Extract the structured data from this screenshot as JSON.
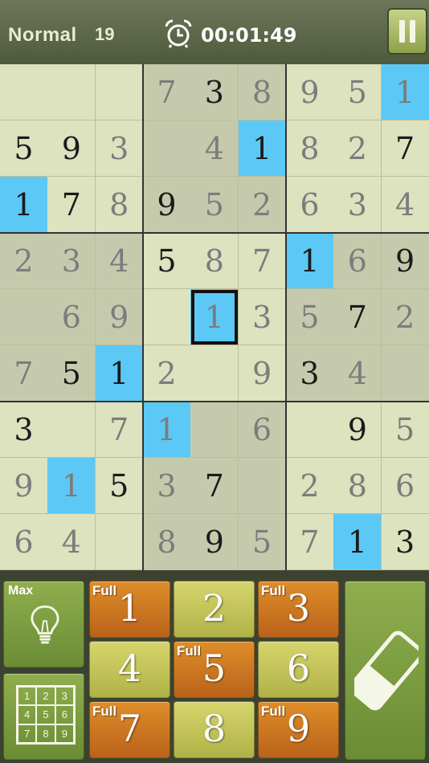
{
  "header": {
    "difficulty": "Normal",
    "puzzle_number": "19",
    "timer": "00:01:49",
    "clock_icon": "alarm-clock-icon",
    "pause_icon": "pause-icon"
  },
  "board": {
    "rows": [
      [
        "",
        "",
        "",
        "7",
        "3",
        "8",
        "9",
        "5",
        "1"
      ],
      [
        "5",
        "9",
        "3",
        "",
        "4",
        "1",
        "8",
        "2",
        "7"
      ],
      [
        "1",
        "7",
        "8",
        "9",
        "5",
        "2",
        "6",
        "3",
        "4"
      ],
      [
        "2",
        "3",
        "4",
        "5",
        "8",
        "7",
        "1",
        "6",
        "9"
      ],
      [
        "",
        "6",
        "9",
        "",
        "1",
        "3",
        "5",
        "7",
        "2"
      ],
      [
        "7",
        "5",
        "1",
        "2",
        "",
        "9",
        "3",
        "4",
        ""
      ],
      [
        "3",
        "",
        "7",
        "1",
        "",
        "6",
        "",
        "9",
        "5"
      ],
      [
        "9",
        "1",
        "5",
        "3",
        "7",
        "",
        "2",
        "8",
        "6"
      ],
      [
        "6",
        "4",
        "",
        "8",
        "9",
        "5",
        "7",
        "1",
        "3"
      ]
    ],
    "given": [
      [
        0,
        0,
        0,
        0,
        1,
        0,
        0,
        0,
        0
      ],
      [
        1,
        1,
        0,
        0,
        0,
        1,
        0,
        0,
        1
      ],
      [
        1,
        1,
        0,
        1,
        0,
        0,
        0,
        0,
        0
      ],
      [
        0,
        0,
        0,
        1,
        0,
        0,
        1,
        0,
        1
      ],
      [
        0,
        0,
        0,
        0,
        0,
        0,
        0,
        1,
        0
      ],
      [
        0,
        1,
        1,
        0,
        0,
        0,
        1,
        0,
        0
      ],
      [
        1,
        0,
        0,
        0,
        0,
        0,
        0,
        1,
        0
      ],
      [
        0,
        0,
        1,
        0,
        1,
        0,
        0,
        0,
        0
      ],
      [
        0,
        0,
        0,
        0,
        1,
        0,
        0,
        1,
        1
      ]
    ],
    "highlighted": [
      [
        0,
        8
      ],
      [
        1,
        5
      ],
      [
        2,
        0
      ],
      [
        3,
        6
      ],
      [
        4,
        4
      ],
      [
        5,
        2
      ],
      [
        6,
        3
      ],
      [
        7,
        1
      ],
      [
        8,
        7
      ]
    ],
    "selected": [
      4,
      4
    ],
    "colors": {
      "highlight": "#5cc8f5",
      "given_text": "#1b1b1b",
      "entered_text": "#7c7c7c"
    }
  },
  "controls": {
    "hint_label": "Max",
    "hint_icon": "lightbulb-icon",
    "notes_grid": [
      "1",
      "2",
      "3",
      "4",
      "5",
      "6",
      "7",
      "8",
      "9"
    ],
    "eraser_icon": "eraser-icon",
    "numbers": [
      {
        "value": "1",
        "full_label": "Full",
        "is_full": true
      },
      {
        "value": "2",
        "full_label": "",
        "is_full": false
      },
      {
        "value": "3",
        "full_label": "Full",
        "is_full": true
      },
      {
        "value": "4",
        "full_label": "",
        "is_full": false
      },
      {
        "value": "5",
        "full_label": "Full",
        "is_full": true
      },
      {
        "value": "6",
        "full_label": "",
        "is_full": false
      },
      {
        "value": "7",
        "full_label": "Full",
        "is_full": true
      },
      {
        "value": "8",
        "full_label": "",
        "is_full": false
      },
      {
        "value": "9",
        "full_label": "Full",
        "is_full": true
      }
    ]
  }
}
